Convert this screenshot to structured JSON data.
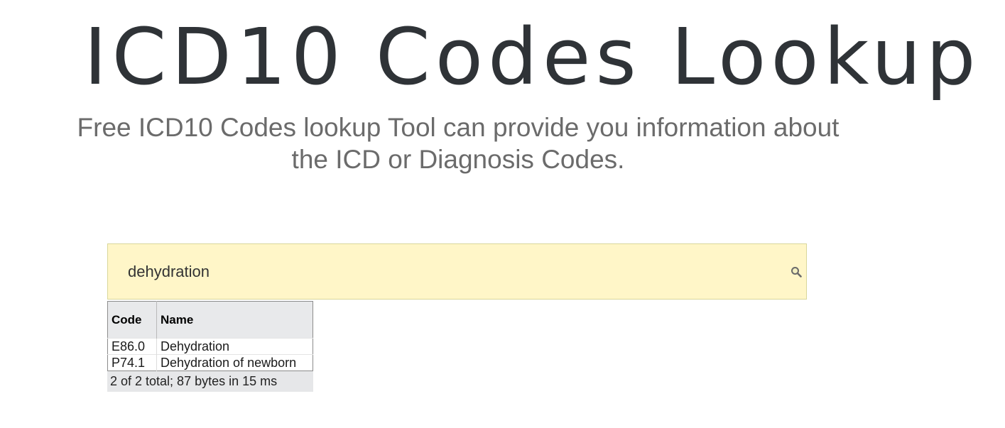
{
  "header": {
    "title": "ICD10 Codes Lookup",
    "subtitle": "Free ICD10 Codes lookup Tool can provide you information about the ICD or Diagnosis Codes."
  },
  "search": {
    "value": "dehydration",
    "icon": "search-icon"
  },
  "results": {
    "columns": [
      "Code",
      "Name"
    ],
    "rows": [
      {
        "code": "E86.0",
        "name": "Dehydration"
      },
      {
        "code": "P74.1",
        "name": "Dehydration of newborn"
      }
    ],
    "footer": "2 of 2 total; 87  bytes in 15 ms"
  },
  "colors": {
    "search_background": "#fff6c8",
    "title": "#2f3337",
    "subtitle": "#6b6b6b"
  }
}
